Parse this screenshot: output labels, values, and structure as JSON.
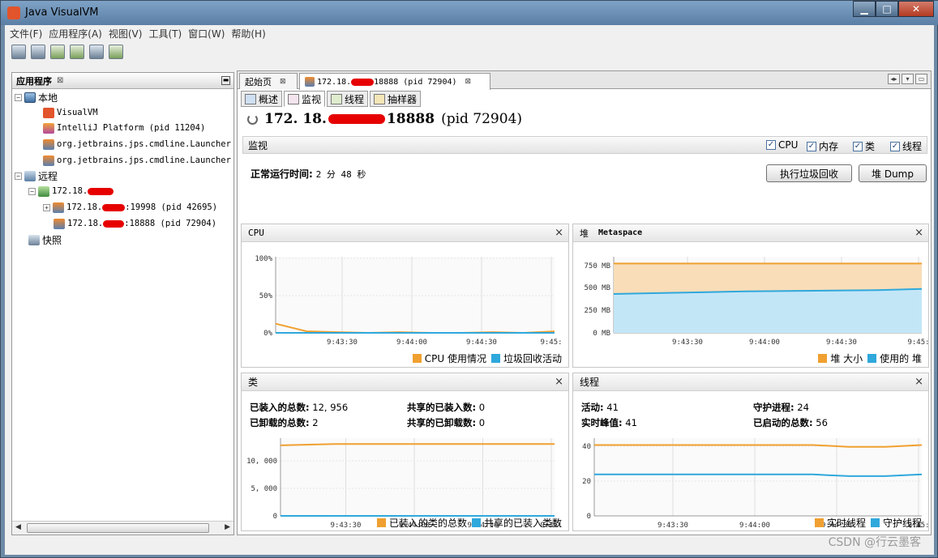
{
  "window": {
    "title": "Java VisualVM"
  },
  "menu": [
    "文件(F)",
    "应用程序(A)",
    "视图(V)",
    "工具(T)",
    "窗口(W)",
    "帮助(H)"
  ],
  "left_panel": {
    "title": "应用程序",
    "close": "⊠",
    "tree": {
      "local": "本地",
      "visualvm": "VisualVM",
      "intellij": "IntelliJ Platform (pid 11204)",
      "launcher1": "org.jetbrains.jps.cmdline.Launcher",
      "launcher2": "org.jetbrains.jps.cmdline.Launcher",
      "remote": "远程",
      "host": "172.18.",
      "proc1_a": "172.18.",
      "proc1_b": ":19998 (pid 42695)",
      "proc2_a": "172.18.",
      "proc2_b": ":18888 (pid 72904)",
      "snapshot": "快照"
    }
  },
  "tabs": {
    "start": "起始页",
    "host_a": "172.18.",
    "host_b": "18888 (pid 72904)",
    "close": "⊠"
  },
  "subtabs": [
    "概述",
    "监视",
    "线程",
    "抽样器"
  ],
  "header": {
    "host_a": "172. 18.",
    "host_b": "18888",
    "pid": "(pid 72904)"
  },
  "monitor": {
    "title": "监视",
    "checks": [
      {
        "label": "CPU",
        "checked": true
      },
      {
        "label": "内存",
        "checked": true
      },
      {
        "label": "类",
        "checked": true
      },
      {
        "label": "线程",
        "checked": true
      }
    ],
    "uptime_label": "正常运行时间:",
    "uptime_value": "2 分 48 秒",
    "gc_button": "执行垃圾回收",
    "dump_button": "堆 Dump"
  },
  "cpu_panel": {
    "title": "CPU",
    "close": "×",
    "legend": [
      "CPU 使用情况",
      "垃圾回收活动"
    ]
  },
  "heap_panel": {
    "title": "堆",
    "tab": "Metaspace",
    "close": "×",
    "legend": [
      "堆 大小",
      "使用的 堆"
    ]
  },
  "class_panel": {
    "title": "类",
    "close": "×",
    "stats": {
      "loaded_label": "已装入的总数:",
      "loaded_value": "12, 956",
      "unloaded_label": "已卸载的总数:",
      "unloaded_value": "2",
      "shared_loaded_label": "共享的已装入数:",
      "shared_loaded_value": "0",
      "shared_unloaded_label": "共享的已卸载数:",
      "shared_unloaded_value": "0"
    },
    "legend": [
      "已装入的类的总数",
      "共享的已装入类数"
    ]
  },
  "thread_panel": {
    "title": "线程",
    "close": "×",
    "stats": {
      "live_label": "活动:",
      "live_value": "41",
      "peak_label": "实时峰值:",
      "peak_value": "41",
      "daemon_label": "守护进程:",
      "daemon_value": "24",
      "started_label": "已启动的总数:",
      "started_value": "56"
    },
    "legend": [
      "实时线程",
      "守护线程"
    ]
  },
  "colors": {
    "orange": "#f0a030",
    "blue": "#2fa8dc",
    "heap_fill": "#f8ddb8",
    "used_fill": "#c3e6f7"
  },
  "chart_data": [
    {
      "type": "line",
      "title": "CPU",
      "x": [
        "9:43:30",
        "9:44:00",
        "9:44:30",
        "9:45:"
      ],
      "yticks": [
        "100%",
        "50%",
        "0%"
      ],
      "ylim": [
        0,
        100
      ],
      "series": [
        {
          "name": "CPU 使用情况",
          "color": "#f0a030",
          "values": [
            12,
            2,
            1,
            0,
            1,
            0,
            0,
            1,
            0,
            2
          ]
        },
        {
          "name": "垃圾回收活动",
          "color": "#2fa8dc",
          "values": [
            0,
            0,
            0,
            0,
            0,
            0,
            0,
            0,
            0,
            0
          ]
        }
      ]
    },
    {
      "type": "area",
      "title": "堆",
      "x": [
        "9:43:30",
        "9:44:00",
        "9:44:30",
        "9:45:"
      ],
      "yticks": [
        "750 MB",
        "500 MB",
        "250 MB",
        "0 MB"
      ],
      "ylim": [
        0,
        900
      ],
      "series": [
        {
          "name": "堆 大小",
          "color": "#f0a030",
          "values": [
            820,
            820,
            820,
            820,
            820,
            820,
            820,
            820
          ]
        },
        {
          "name": "使用的 堆",
          "color": "#2fa8dc",
          "values": [
            460,
            470,
            480,
            490,
            495,
            500,
            505,
            520
          ]
        }
      ]
    },
    {
      "type": "line",
      "title": "类",
      "x": [
        "9:43:30",
        "9:44:00",
        "9:44:30",
        "9:45:"
      ],
      "yticks": [
        "10, 000",
        "5, 000",
        "0"
      ],
      "ylim": [
        0,
        14000
      ],
      "series": [
        {
          "name": "已装入的类的总数",
          "color": "#f0a030",
          "values": [
            12700,
            12950,
            12956,
            12956,
            12956,
            12956
          ]
        },
        {
          "name": "共享的已装入类数",
          "color": "#2fa8dc",
          "values": [
            0,
            0,
            0,
            0,
            0,
            0
          ]
        }
      ]
    },
    {
      "type": "line",
      "title": "线程",
      "x": [
        "9:43:30",
        "9:44:00",
        "9:44:30",
        "9:45:"
      ],
      "yticks": [
        "40",
        "20",
        "0"
      ],
      "ylim": [
        0,
        45
      ],
      "series": [
        {
          "name": "实时线程",
          "color": "#f0a030",
          "values": [
            41,
            41,
            41,
            41,
            41,
            41,
            41,
            40,
            40,
            41
          ]
        },
        {
          "name": "守护线程",
          "color": "#2fa8dc",
          "values": [
            24,
            24,
            24,
            24,
            24,
            24,
            24,
            23,
            23,
            24
          ]
        }
      ]
    }
  ],
  "watermark": "CSDN @行云墨客"
}
